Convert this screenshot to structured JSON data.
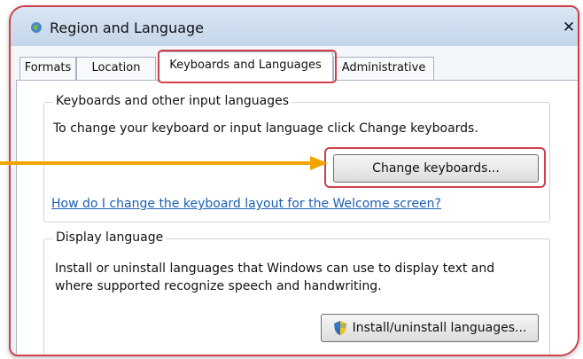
{
  "window": {
    "title": "Region and Language",
    "close_glyph": "✕"
  },
  "tabs": [
    {
      "label": "Formats",
      "active": false
    },
    {
      "label": "Location",
      "active": false
    },
    {
      "label": "Keyboards and Languages",
      "active": true
    },
    {
      "label": "Administrative",
      "active": false
    }
  ],
  "keyboards_group": {
    "legend": "Keyboards and other input languages",
    "description": "To change your keyboard or input language click Change keyboards.",
    "change_button": "Change keyboards...",
    "help_link": "How do I change the keyboard layout for the Welcome screen?"
  },
  "display_group": {
    "legend": "Display language",
    "description_line1": "Install or uninstall languages that Windows can use to display text and",
    "description_line2": "where supported recognize speech and handwriting.",
    "install_button": "Install/uninstall languages..."
  },
  "colors": {
    "highlight": "#d0404a",
    "arrow": "#f0a500",
    "link": "#1a5fb4"
  },
  "icons": {
    "title": "globe-icon",
    "shield": "uac-shield-icon"
  }
}
